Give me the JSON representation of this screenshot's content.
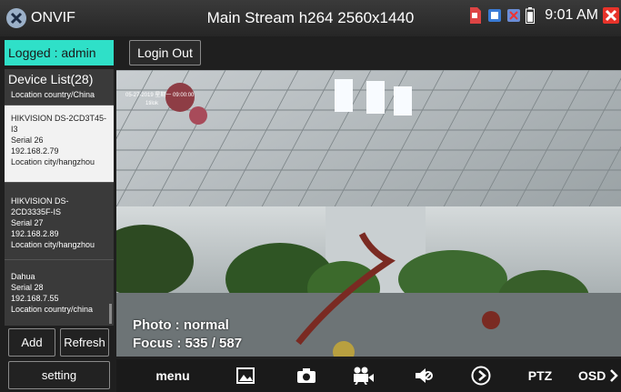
{
  "header": {
    "app_name": "ONVIF",
    "title": "Main Stream h264 2560x1440",
    "time": "9:01 AM"
  },
  "login": {
    "status": "Logged : admin",
    "logout_label": "Login Out"
  },
  "device_list": {
    "header": "Device List(28)",
    "top_partial": "Location country/China",
    "items": [
      {
        "name": "HIKVISION DS-2CD3T45-I3",
        "serial": "Serial 26",
        "ip": "192.168.2.79",
        "location": "Location city/hangzhou"
      },
      {
        "name": "HIKVISION DS-2CD3335F-IS",
        "serial": "Serial 27",
        "ip": "192.168.2.89",
        "location": "Location city/hangzhou"
      },
      {
        "name": "Dahua",
        "serial": "Serial 28",
        "ip": "192.168.7.55",
        "location": "Location country/china"
      }
    ]
  },
  "buttons": {
    "add": "Add",
    "refresh": "Refresh",
    "setting": "setting"
  },
  "video": {
    "photo": "Photo : normal",
    "focus": "Focus : 535 / 587",
    "osd_line1": "05-27-2019 星期一 09:00:00",
    "osd_line2": "1tilok"
  },
  "toolbar": {
    "menu": "menu",
    "ptz": "PTZ",
    "osd": "OSD"
  },
  "colors": {
    "accent": "#2fe0c8",
    "topbar": "#2e2e2e",
    "close": "#e8332a"
  }
}
